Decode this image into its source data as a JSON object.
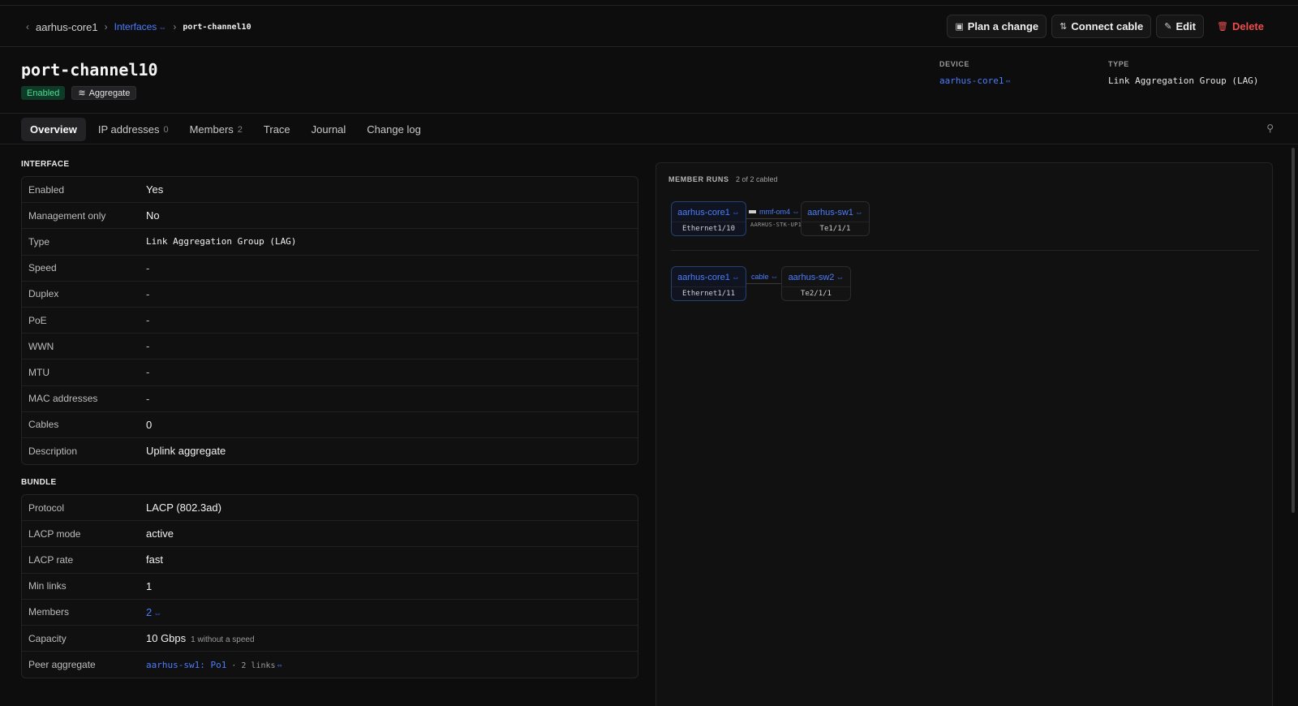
{
  "breadcrumb": {
    "device": "aarhus-core1",
    "section": "Interfaces",
    "current": "port-channel10"
  },
  "actions": {
    "plan": "Plan a change",
    "connect": "Connect cable",
    "edit": "Edit",
    "delete": "Delete"
  },
  "header": {
    "title": "port-channel10",
    "badge_status": "Enabled",
    "badge_kind": "Aggregate",
    "device_label": "DEVICE",
    "device_value": "aarhus-core1",
    "type_label": "TYPE",
    "type_value": "Link Aggregation Group (LAG)"
  },
  "tabs": [
    {
      "label": "Overview",
      "count": ""
    },
    {
      "label": "IP addresses",
      "count": "0"
    },
    {
      "label": "Members",
      "count": "2"
    },
    {
      "label": "Trace",
      "count": ""
    },
    {
      "label": "Journal",
      "count": ""
    },
    {
      "label": "Change log",
      "count": ""
    }
  ],
  "interface": {
    "title": "INTERFACE",
    "rows": [
      {
        "k": "Enabled",
        "v": "Yes"
      },
      {
        "k": "Management only",
        "v": "No"
      },
      {
        "k": "Type",
        "v": "Link Aggregation Group (LAG)"
      },
      {
        "k": "Speed",
        "v": "-"
      },
      {
        "k": "Duplex",
        "v": "-"
      },
      {
        "k": "PoE",
        "v": "-"
      },
      {
        "k": "WWN",
        "v": "-"
      },
      {
        "k": "MTU",
        "v": "-"
      },
      {
        "k": "MAC addresses",
        "v": "-"
      },
      {
        "k": "Cables",
        "v": "0"
      },
      {
        "k": "Description",
        "v": "Uplink aggregate"
      }
    ]
  },
  "bundle": {
    "title": "BUNDLE",
    "rows": [
      {
        "k": "Protocol",
        "v": "LACP (802.3ad)"
      },
      {
        "k": "LACP mode",
        "v": "active"
      },
      {
        "k": "LACP rate",
        "v": "fast"
      },
      {
        "k": "Min links",
        "v": "1"
      },
      {
        "k": "Members",
        "v": "2"
      },
      {
        "k": "Capacity",
        "v": "10 Gbps",
        "note": "1 without a speed"
      },
      {
        "k": "Peer aggregate",
        "v": "aarhus-sw1: Po1",
        "note": "· 2 links"
      }
    ]
  },
  "member_runs": {
    "title": "MEMBER RUNS",
    "subtitle": "2 of 2 cabled",
    "runs": [
      {
        "a_device": "aarhus-core1",
        "a_port": "Ethernet1/10",
        "cable": "mmf-om4",
        "cable_label": "AARHUS-STK-UP1",
        "b_device": "aarhus-sw1",
        "b_port": "Te1/1/1"
      },
      {
        "a_device": "aarhus-core1",
        "a_port": "Ethernet1/11",
        "cable": "cable",
        "cable_label": "",
        "b_device": "aarhus-sw2",
        "b_port": "Te2/1/1"
      }
    ]
  },
  "icons": {
    "link": "link-icon",
    "pin": "pin-icon",
    "trash": "trash-icon"
  }
}
